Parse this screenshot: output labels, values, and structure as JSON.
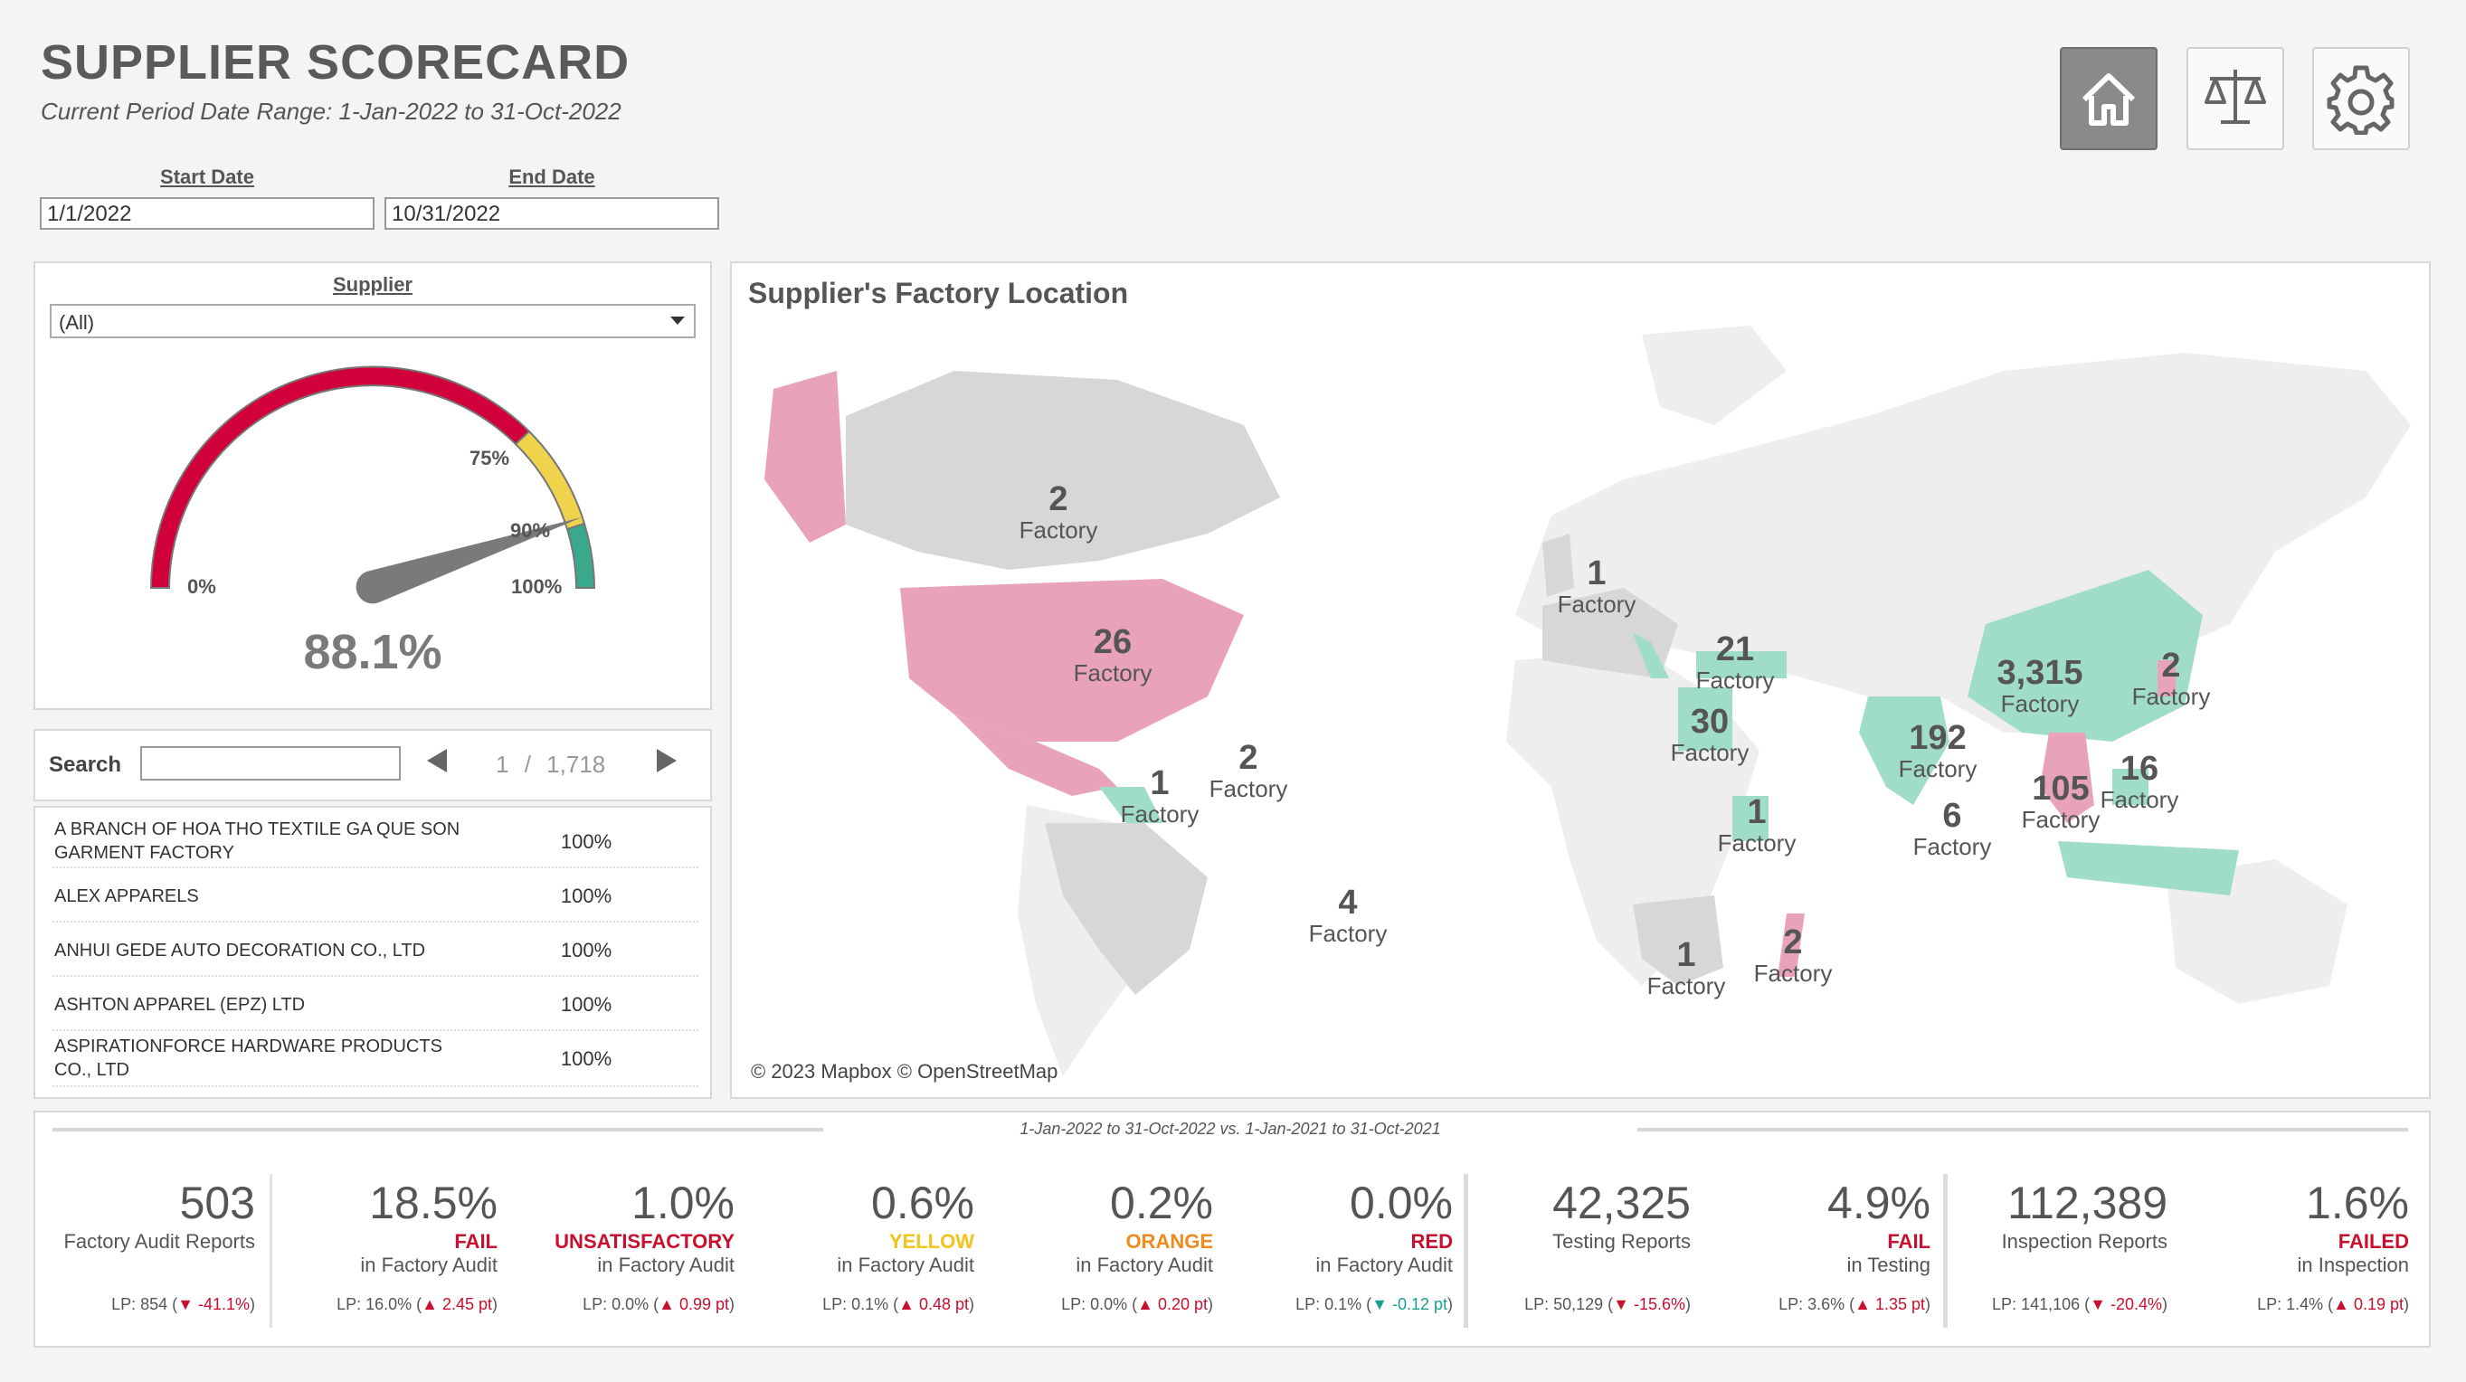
{
  "header": {
    "title": "SUPPLIER SCORECARD",
    "subtitle": "Current Period Date Range: 1-Jan-2022 to 31-Oct-2022"
  },
  "dates": {
    "start_label": "Start Date",
    "start_value": "1/1/2022",
    "end_label": "End Date",
    "end_value": "10/31/2022"
  },
  "nav": {
    "icons": [
      "home-icon",
      "scale-icon",
      "gear-icon"
    ],
    "active": "home"
  },
  "supplier_filter": {
    "label": "Supplier",
    "value": "(All)"
  },
  "gauge": {
    "value_text": "88.1%",
    "value": 88.1,
    "ticks": [
      "0%",
      "75%",
      "90%",
      "100%"
    ],
    "colors": {
      "red": "#d1003a",
      "yellow": "#f0d34c",
      "green": "#3aa88a",
      "needle": "#7a7a7a"
    }
  },
  "search": {
    "label": "Search",
    "placeholder": "",
    "page": "1",
    "separator": "/",
    "total": "1,718"
  },
  "supplier_list": [
    {
      "name": "A BRANCH OF HOA THO TEXTILE GA QUE SON GARMENT FACTORY",
      "score": "100%"
    },
    {
      "name": "ALEX APPARELS",
      "score": "100%"
    },
    {
      "name": "ANHUI GEDE AUTO DECORATION CO., LTD",
      "score": "100%"
    },
    {
      "name": "ASHTON APPAREL (EPZ) LTD",
      "score": "100%"
    },
    {
      "name": "ASPIRATIONFORCE HARDWARE PRODUCTS CO., LTD",
      "score": "100%"
    }
  ],
  "map": {
    "title": "Supplier's Factory Location",
    "credit": "© 2023 Mapbox © OpenStreetMap",
    "colors": {
      "pink": "#e9a3b8",
      "teal": "#9fdcca",
      "gray": "#d7d7d7",
      "land": "#eeeeee",
      "water": "#ffffff"
    },
    "labels": [
      {
        "count": "2",
        "unit": "Factory",
        "region": "Canada"
      },
      {
        "count": "26",
        "unit": "Factory",
        "region": "United States"
      },
      {
        "count": "1",
        "unit": "Factory",
        "region": "Central America"
      },
      {
        "count": "2",
        "unit": "Factory",
        "region": "Caribbean"
      },
      {
        "count": "4",
        "unit": "Factory",
        "region": "Brazil"
      },
      {
        "count": "1",
        "unit": "Factory",
        "region": "United Kingdom"
      },
      {
        "count": "21",
        "unit": "Factory",
        "region": "Turkey"
      },
      {
        "count": "30",
        "unit": "Factory",
        "region": "Egypt"
      },
      {
        "count": "1",
        "unit": "Factory",
        "region": "Kenya"
      },
      {
        "count": "1",
        "unit": "Factory",
        "region": "Southern Africa"
      },
      {
        "count": "2",
        "unit": "Factory",
        "region": "Madagascar"
      },
      {
        "count": "3,315",
        "unit": "Factory",
        "region": "China"
      },
      {
        "count": "2",
        "unit": "Factory",
        "region": "Korea"
      },
      {
        "count": "192",
        "unit": "Factory",
        "region": "India"
      },
      {
        "count": "6",
        "unit": "Factory",
        "region": "Sri Lanka"
      },
      {
        "count": "105",
        "unit": "Factory",
        "region": "Vietnam"
      },
      {
        "count": "16",
        "unit": "Factory",
        "region": "Philippines"
      }
    ]
  },
  "comparison": {
    "text": "1-Jan-2022 to 31-Oct-2022 vs. 1-Jan-2021 to 31-Oct-2021"
  },
  "kpis": [
    {
      "value": "503",
      "label1": "",
      "label2": "Factory Audit Reports",
      "label1_color": "",
      "lp": "LP: 854 (",
      "delta": "▼ -41.1%",
      "delta_color": "#c8102e",
      "lp_end": ")"
    },
    {
      "value": "18.5%",
      "label1": "FAIL",
      "label2": "in Factory Audit",
      "label1_color": "#c8102e",
      "lp": "LP: 16.0% (",
      "delta": "▲ 2.45 pt",
      "delta_color": "#c8102e",
      "lp_end": ")"
    },
    {
      "value": "1.0%",
      "label1": "UNSATISFACTORY",
      "label2": "in Factory Audit",
      "label1_color": "#c8102e",
      "lp": "LP: 0.0% (",
      "delta": "▲ 0.99 pt",
      "delta_color": "#c8102e",
      "lp_end": ")"
    },
    {
      "value": "0.6%",
      "label1": "YELLOW",
      "label2": "in Factory Audit",
      "label1_color": "#f0c419",
      "lp": "LP: 0.1% (",
      "delta": "▲ 0.48 pt",
      "delta_color": "#c8102e",
      "lp_end": ")"
    },
    {
      "value": "0.2%",
      "label1": "ORANGE",
      "label2": "in Factory Audit",
      "label1_color": "#f08a1c",
      "lp": "LP: 0.0% (",
      "delta": "▲ 0.20 pt",
      "delta_color": "#c8102e",
      "lp_end": ")"
    },
    {
      "value": "0.0%",
      "label1": "RED",
      "label2": "in Factory Audit",
      "label1_color": "#c8102e",
      "lp": "LP: 0.1% (",
      "delta": "▼ -0.12 pt",
      "delta_color": "#1a9e8f",
      "lp_end": ")"
    },
    {
      "value": "42,325",
      "label1": "",
      "label2": "Testing Reports",
      "label1_color": "",
      "lp": "LP: 50,129 (",
      "delta": "▼ -15.6%",
      "delta_color": "#c8102e",
      "lp_end": ")"
    },
    {
      "value": "4.9%",
      "label1": "FAIL",
      "label2": "in Testing",
      "label1_color": "#c8102e",
      "lp": "LP: 3.6% (",
      "delta": "▲ 1.35 pt",
      "delta_color": "#c8102e",
      "lp_end": ")"
    },
    {
      "value": "112,389",
      "label1": "",
      "label2": "Inspection Reports",
      "label1_color": "",
      "lp": "LP: 141,106 (",
      "delta": "▼ -20.4%",
      "delta_color": "#c8102e",
      "lp_end": ")"
    },
    {
      "value": "1.6%",
      "label1": "FAILED",
      "label2": "in Inspection",
      "label1_color": "#c8102e",
      "lp": "LP: 1.4% (",
      "delta": "▲ 0.19 pt",
      "delta_color": "#c8102e",
      "lp_end": ")"
    }
  ]
}
